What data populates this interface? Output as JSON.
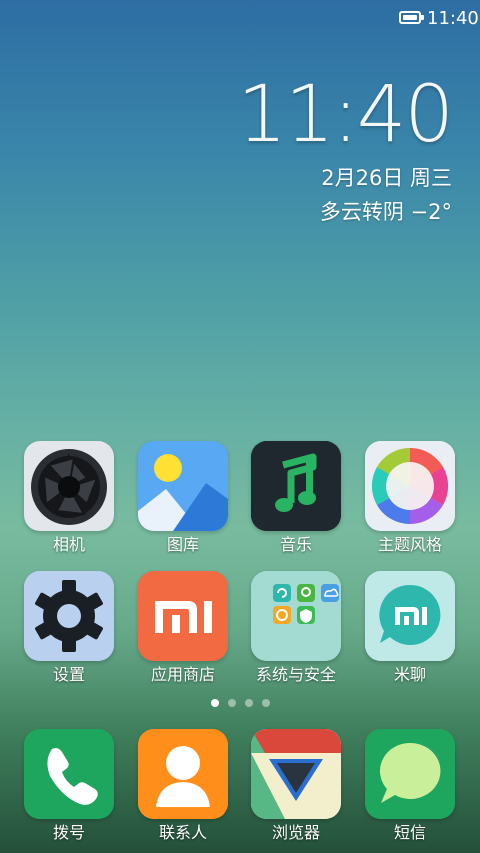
{
  "status_bar": {
    "time": "11:40",
    "battery_icon": "battery-icon"
  },
  "clock_widget": {
    "time": "11:40",
    "date": "2月26日 周三",
    "weather": "多云转阴  −2°"
  },
  "apps_row1": [
    {
      "label": "相机",
      "icon": "camera-icon"
    },
    {
      "label": "图库",
      "icon": "gallery-icon"
    },
    {
      "label": "音乐",
      "icon": "music-icon"
    },
    {
      "label": "主题风格",
      "icon": "theme-icon"
    }
  ],
  "apps_row2": [
    {
      "label": "设置",
      "icon": "settings-icon"
    },
    {
      "label": "应用商店",
      "icon": "app-store-icon"
    },
    {
      "label": "系统与安全",
      "icon": "folder-icon"
    },
    {
      "label": "米聊",
      "icon": "miliao-icon"
    }
  ],
  "page_indicator": {
    "count": 4,
    "active": 0
  },
  "dock": [
    {
      "label": "拨号",
      "icon": "phone-icon"
    },
    {
      "label": "联系人",
      "icon": "contacts-icon"
    },
    {
      "label": "浏览器",
      "icon": "browser-icon"
    },
    {
      "label": "短信",
      "icon": "messages-icon"
    }
  ],
  "mi_logo_text": "MI",
  "colors": {
    "camera_bg": "#e3e6ea",
    "gallery_bg": "#4fa2f2",
    "music_bg": "#1f2a30",
    "music_accent": "#28b463",
    "theme_bg": "#e9eef4",
    "settings_bg": "#b7cfee",
    "app_store_bg": "#f0663f",
    "folder_bg": "#9ed8d0",
    "miliao_bg": "#bde8e6",
    "miliao_accent": "#2db7ad",
    "phone_bg": "#1fa860",
    "contacts_bg": "#ff8f1a",
    "messages_bg": "#1fa860"
  }
}
